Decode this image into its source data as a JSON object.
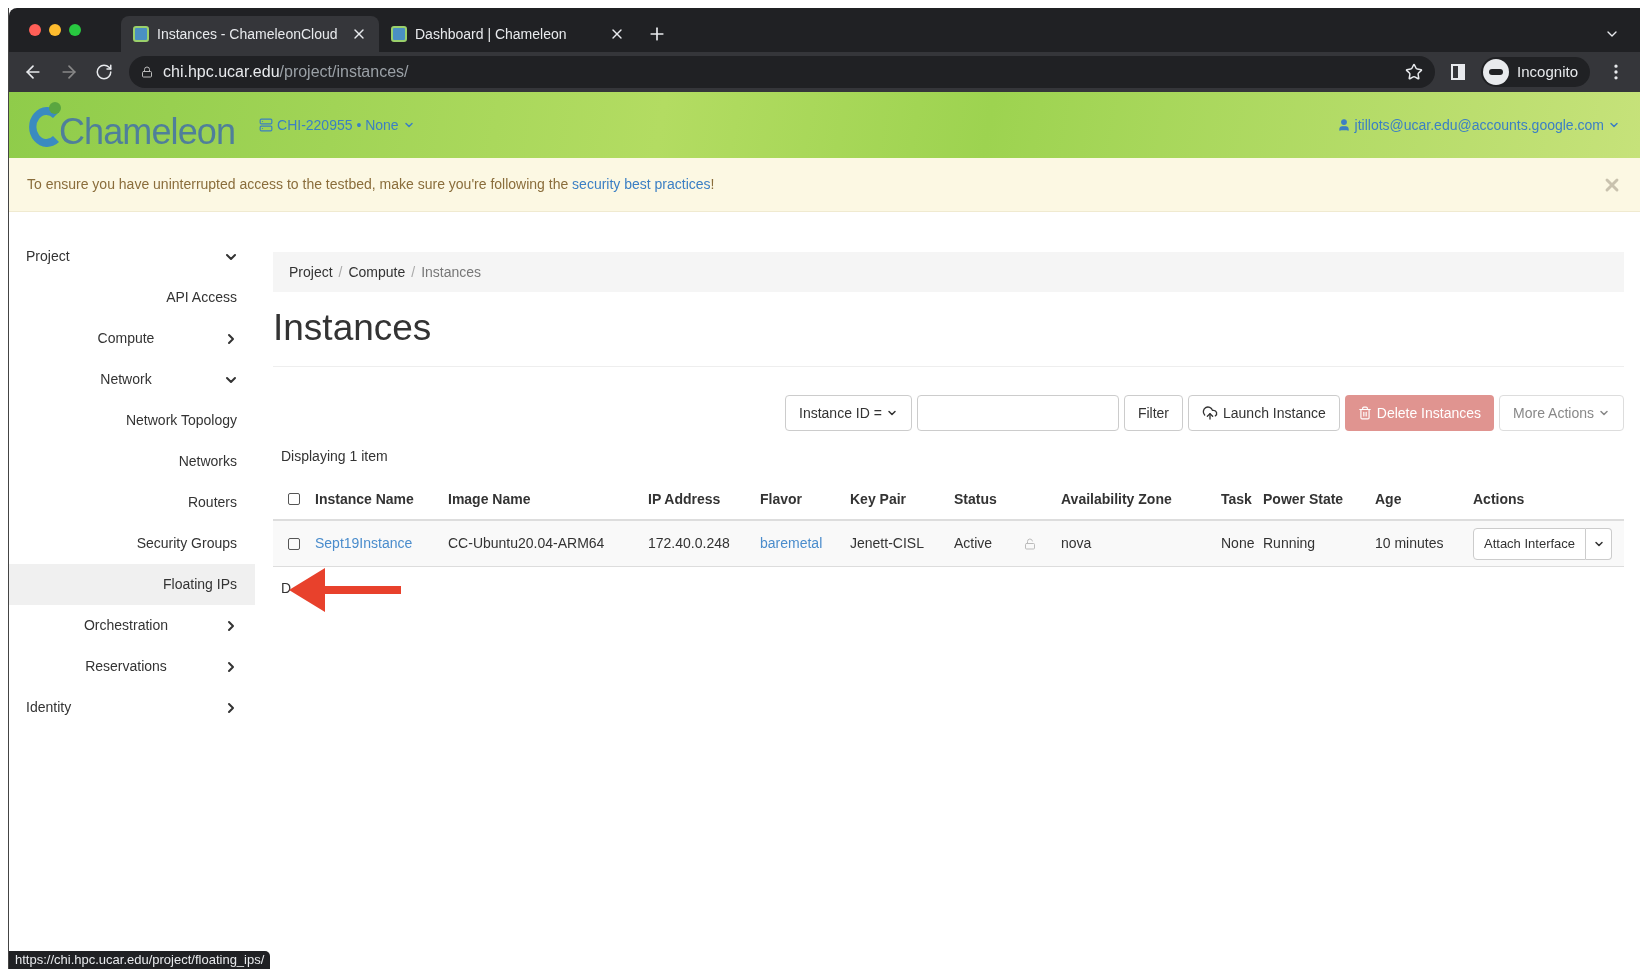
{
  "browser": {
    "tabs": [
      {
        "title": "Instances - ChameleonCloud",
        "selected": true
      },
      {
        "title": "Dashboard | Chameleon",
        "selected": false
      }
    ],
    "url_host": "chi.hpc.ucar.edu",
    "url_path": "/project/instances/",
    "profile": "Incognito"
  },
  "header": {
    "logo": "Chameleon",
    "project": "CHI-220955 • None",
    "user": "jtillots@ucar.edu@accounts.google.com"
  },
  "alert": {
    "text": "To ensure you have uninterrupted access to the testbed, make sure you're following the ",
    "link": "security best practices",
    "end": "!"
  },
  "sidebar": [
    {
      "label": "Project",
      "expanded": true,
      "children": [
        {
          "label": "API Access",
          "selected": false
        },
        {
          "label": "Compute",
          "expanded": false
        },
        {
          "label": "Network",
          "expanded": true,
          "children": [
            {
              "label": "Network Topology",
              "selected": false
            },
            {
              "label": "Networks",
              "selected": false
            },
            {
              "label": "Routers",
              "selected": false
            },
            {
              "label": "Security Groups",
              "selected": false
            },
            {
              "label": "Floating IPs",
              "selected": true
            }
          ]
        },
        {
          "label": "Orchestration",
          "expanded": false
        },
        {
          "label": "Reservations",
          "expanded": false
        }
      ]
    },
    {
      "label": "Identity",
      "expanded": false
    }
  ],
  "breadcrumb": [
    {
      "kind": "link",
      "text": "Project"
    },
    {
      "kind": "separator",
      "text": "/"
    },
    {
      "kind": "link",
      "text": "Compute"
    },
    {
      "kind": "separator",
      "text": "/"
    },
    {
      "kind": "current",
      "text": "Instances"
    }
  ],
  "title": "Instances",
  "toolbar": {
    "filter_field": "Instance ID =",
    "filter_button": "Filter",
    "launch": "Launch Instance",
    "delete": "Delete Instances",
    "delete_disabled": true,
    "more": "More Actions"
  },
  "table": {
    "count": "Displaying 1 item",
    "all_checked": false,
    "columns": [
      "Instance Name",
      "Image Name",
      "IP Address",
      "Flavor",
      "Key Pair",
      "Status",
      "Availability Zone",
      "Task",
      "Power State",
      "Age",
      "Actions"
    ],
    "rows": [
      {
        "checked": false,
        "instance_name": "Sept19Instance",
        "image_name": "CC-Ubuntu20.04-ARM64",
        "ip_address": "172.40.0.248",
        "flavor": "baremetal",
        "key_pair": "Jenett-CISL",
        "status": "Active",
        "locked": false,
        "availability_zone": "nova",
        "task": "None",
        "power_state": "Running",
        "age": "10 minutes",
        "action": "Attach Interface"
      }
    ],
    "footer": "D"
  },
  "status_url": "https://chi.hpc.ucar.edu/project/floating_ips/"
}
